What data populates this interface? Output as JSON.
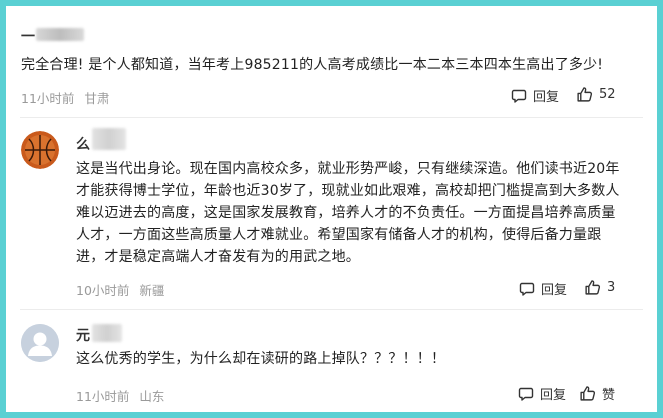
{
  "comments": [
    {
      "name_visible": "一",
      "text": "完全合理! 是个人都知道，当年考上985211的人高考成绩比一本二本三本四本生高出了多少!",
      "time": "11小时前",
      "location": "甘肃",
      "reply_label": "回复",
      "like_label": "52"
    },
    {
      "name_visible": "么",
      "text_lines": [
        "这是当代出身论。现在国内高校众多，就业形势严峻，只有继续深造。他们读书近20年",
        "才能获得博士学位，年龄也近30岁了，现就业如此艰难，高校却把门槛提高到大多数人",
        "难以迈进去的高度，这是国家发展教育，培养人才的不负责任。一方面提昌培养高质量",
        "人才，一方面这些高质量人才难就业。希望国家有储备人才的机构，使得后备力量跟",
        "进，才是稳定高端人才奋发有为的用武之地。"
      ],
      "time": "10小时前",
      "location": "新疆",
      "reply_label": "回复",
      "like_label": "3"
    },
    {
      "name_visible": "元",
      "text": "这么优秀的学生，为什么却在读研的路上掉队？？？！！！",
      "time": "11小时前",
      "location": "山东",
      "reply_label": "回复",
      "like_label": "赞"
    }
  ],
  "icons": {
    "reply": "comment-bubble-icon",
    "like": "thumbs-up-icon",
    "avatar2": "basketball-avatar",
    "avatar3": "default-user-avatar"
  },
  "colors": {
    "background": "#5ad0d3",
    "meta_text": "#9a9a9a"
  }
}
